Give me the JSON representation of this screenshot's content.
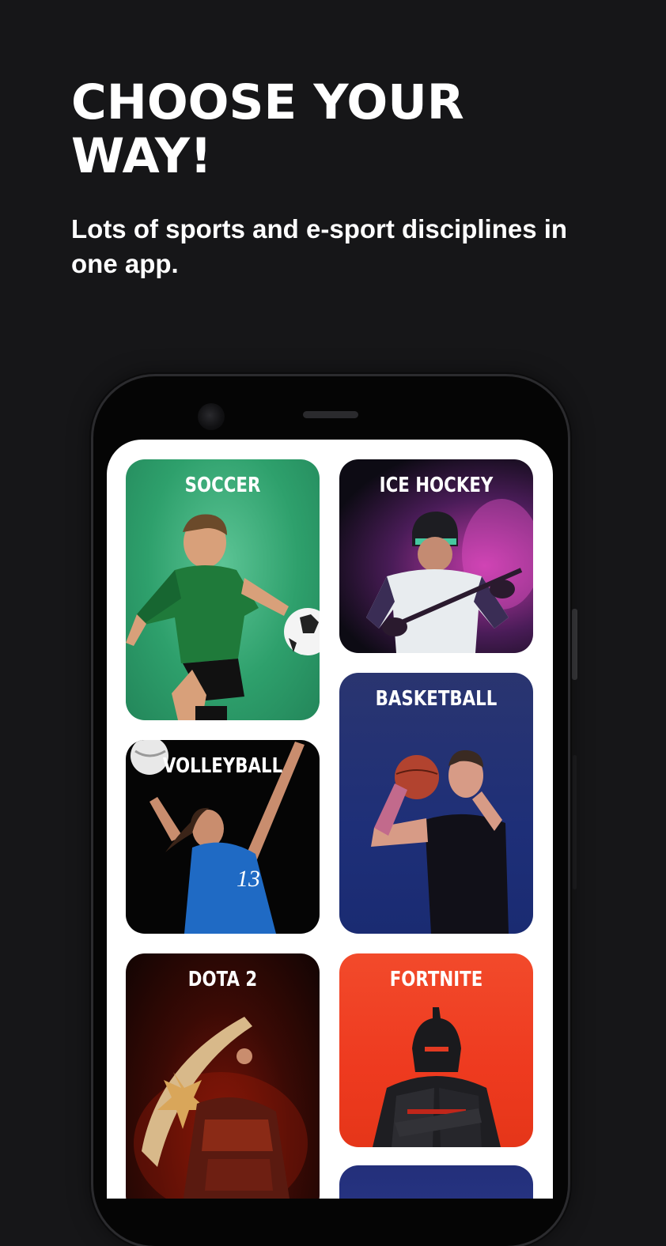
{
  "headline": "CHOOSE YOUR WAY!",
  "subtitle": "Lots of sports and e-sport disciplines in one app.",
  "disciplines": [
    {
      "label": "SOCCER",
      "color": "#2ea06c"
    },
    {
      "label": "ICE HOCKEY",
      "color": "#4a1c58"
    },
    {
      "label": "BASKETBALL",
      "color": "#1e2f78"
    },
    {
      "label": "VOLLEYBALL",
      "color": "#050505"
    },
    {
      "label": "DOTA 2",
      "color": "#3a0a05"
    },
    {
      "label": "FORTNITE",
      "color": "#ee3a1f"
    }
  ],
  "colors": {
    "background": "#161618",
    "text": "#ffffff",
    "screen": "#ffffff"
  }
}
